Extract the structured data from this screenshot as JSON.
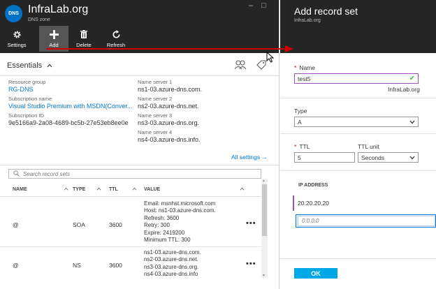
{
  "left_blade": {
    "logo_text": "DNS",
    "title": "InfraLab.org",
    "subtitle": "DNS zone",
    "window_controls": {
      "pin": "–",
      "maximize": "□"
    },
    "toolbar": {
      "settings": "Settings",
      "add": "Add",
      "delete": "Delete",
      "refresh": "Refresh"
    },
    "essentials": {
      "label": "Essentials",
      "resource_group_label": "Resource group",
      "resource_group": "RG-DNS",
      "subscription_name_label": "Subscription name",
      "subscription_name": "Visual Studio Premium with MSDN(Conver...",
      "subscription_id_label": "Subscription ID",
      "subscription_id": "9e5166a9-2a08-4689-bc5b-27e53eb8ee0e",
      "ns1_label": "Name server 1",
      "ns1": "ns1-03.azure-dns.com.",
      "ns2_label": "Name server 2",
      "ns2": "ns2-03.azure-dns.net.",
      "ns3_label": "Name server 3",
      "ns3": "ns3-03.azure-dns.org.",
      "ns4_label": "Name server 4",
      "ns4": "ns4-03.azure-dns.info.",
      "all_settings": "All settings →"
    },
    "search": {
      "placeholder": "Search record sets"
    },
    "table": {
      "columns": {
        "name": "NAME",
        "type": "TYPE",
        "ttl": "TTL",
        "value": "VALUE"
      },
      "rows": [
        {
          "name": "@",
          "type": "SOA",
          "ttl": "3600",
          "value": [
            "Email: msnhst.microsoft.com",
            "Host: ns1-03.azure-dns.com.",
            "Refresh: 3600",
            "Retry: 300",
            "Expire: 2419200",
            "Minimum TTL: 300"
          ],
          "more": "•••"
        },
        {
          "name": "@",
          "type": "NS",
          "ttl": "3600",
          "value": [
            "ns1-03.azure-dns.com.",
            "ns2-03.azure-dns.net.",
            "ns3-03.azure-dns.org.",
            "ns4-03.azure-dns.info"
          ],
          "more": "•••"
        }
      ]
    }
  },
  "right_blade": {
    "title": "Add record set",
    "subtitle": "InfraLab.org",
    "name_label": "Name",
    "name_value": "test5",
    "name_suffix": "InfraLab.org",
    "type_label": "Type",
    "type_value": "A",
    "ttl_label": "TTL",
    "ttl_value": "5",
    "ttl_unit_label": "TTL unit",
    "ttl_unit_value": "Seconds",
    "ip_header": "IP ADDRESS",
    "ip_value": "20.20.20.20",
    "ip_placeholder": "0.0.0.0",
    "ok_label": "OK"
  },
  "colors": {
    "header_bg": "#252525",
    "link": "#0078d4",
    "accent_purple": "#a04fbf",
    "ok_button": "#00a8e8",
    "required": "#dd0000",
    "annotation_arrow": "#cc0000"
  }
}
